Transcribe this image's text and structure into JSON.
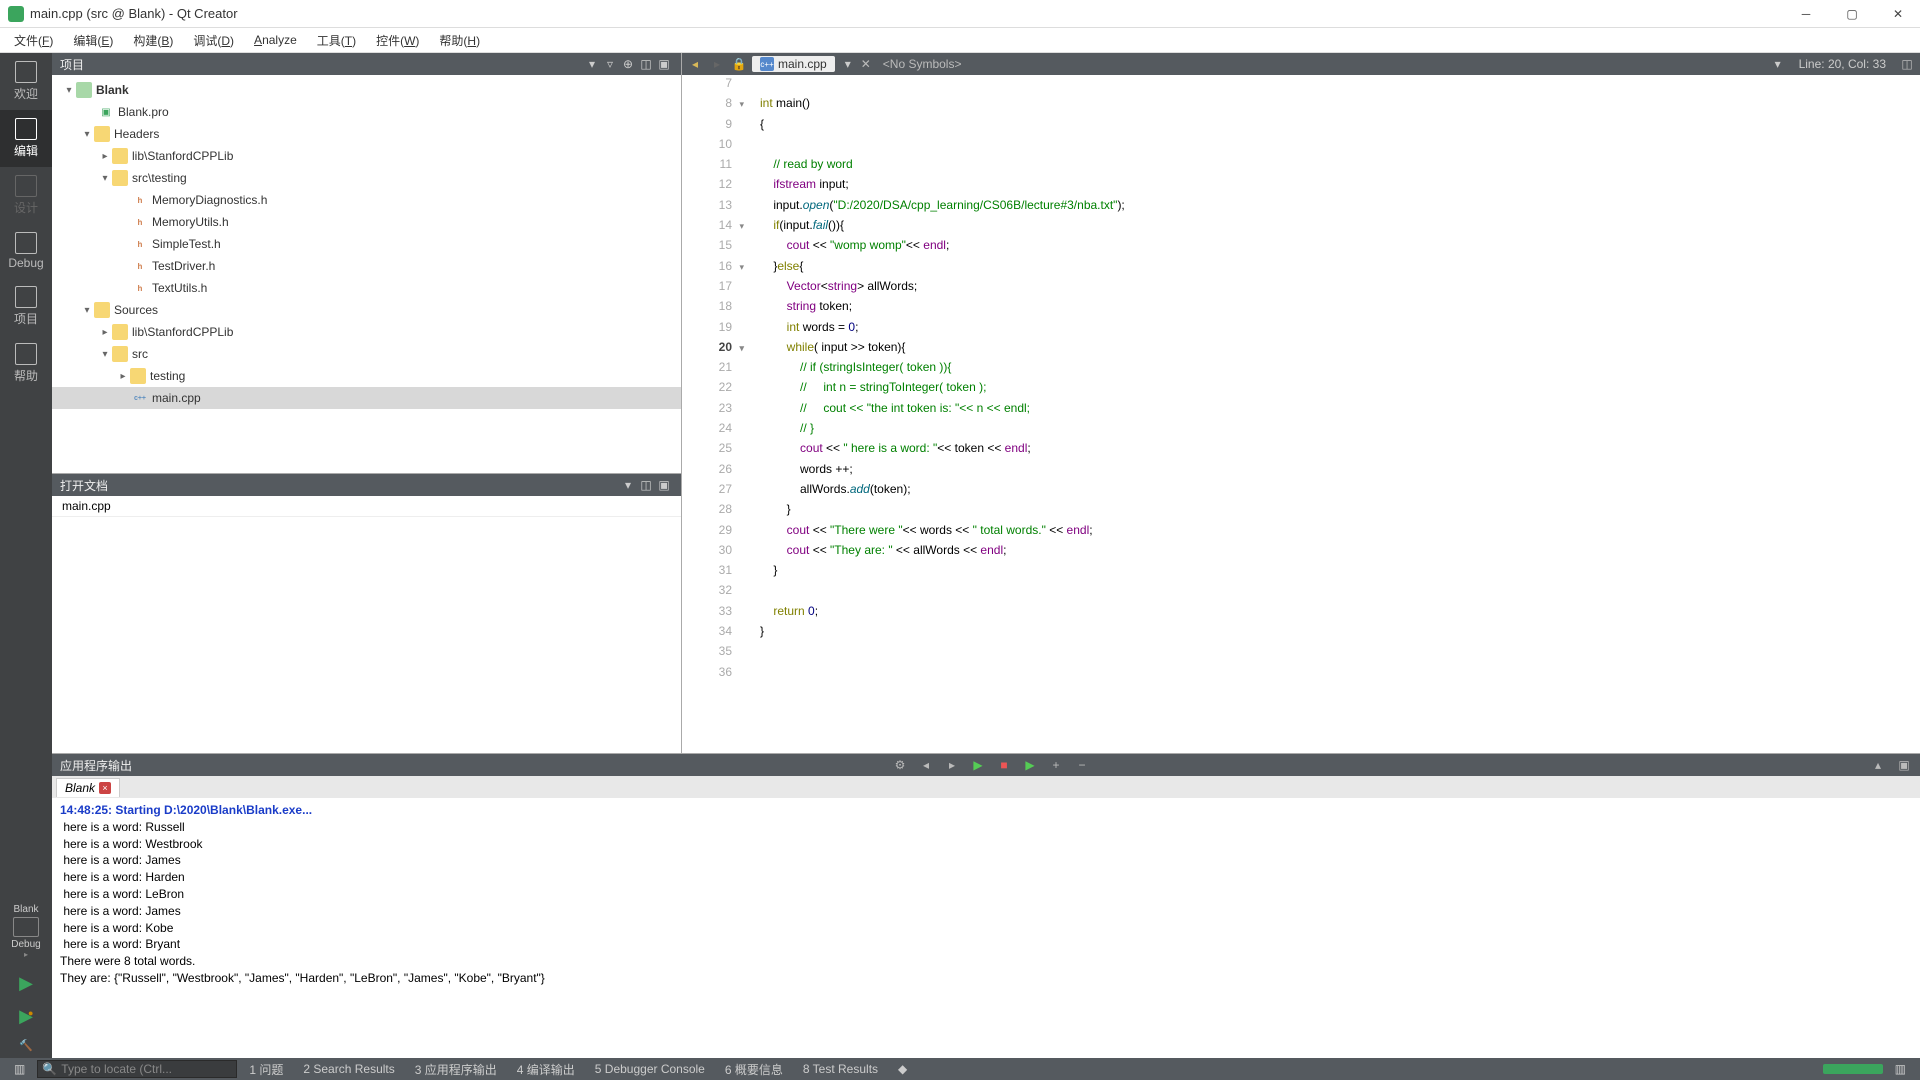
{
  "titlebar": {
    "title": "main.cpp (src @ Blank) - Qt Creator"
  },
  "menubar": {
    "items": [
      "文件(F)",
      "编辑(E)",
      "构建(B)",
      "调试(D)",
      "Analyze",
      "工具(T)",
      "控件(W)",
      "帮助(H)"
    ]
  },
  "leftnav": {
    "items": [
      {
        "label": "欢迎"
      },
      {
        "label": "编辑"
      },
      {
        "label": "设计"
      },
      {
        "label": "Debug"
      },
      {
        "label": "项目"
      },
      {
        "label": "帮助"
      }
    ],
    "target": {
      "name": "Blank",
      "config": "Debug"
    }
  },
  "project_panel": {
    "title": "项目",
    "tree": {
      "root": "Blank",
      "pro_file": "Blank.pro",
      "headers_label": "Headers",
      "lib_folder": "lib\\StanfordCPPLib",
      "testing_folder": "src\\testing",
      "header_files": [
        "MemoryDiagnostics.h",
        "MemoryUtils.h",
        "SimpleTest.h",
        "TestDriver.h",
        "TextUtils.h"
      ],
      "sources_label": "Sources",
      "src_folder": "src",
      "testing_sub": "testing",
      "main_file": "main.cpp"
    }
  },
  "open_docs": {
    "title": "打开文档",
    "items": [
      "main.cpp"
    ]
  },
  "editor": {
    "file": "main.cpp",
    "symbols": "<No Symbols>",
    "cursor": "Line: 20, Col: 33",
    "first_line": 7,
    "current_line": 20
  },
  "output": {
    "title": "应用程序输出",
    "tab": "Blank",
    "start": "14:48:25: Starting D:\\2020\\Blank\\Blank.exe...",
    "lines": [
      "here is a word: Russell",
      "here is a word: Westbrook",
      "here is a word: James",
      "here is a word: Harden",
      "here is a word: LeBron",
      "here is a word: James",
      "here is a word: Kobe",
      "here is a word: Bryant",
      "There were 8 total words.",
      "They are: {\"Russell\", \"Westbrook\", \"James\", \"Harden\", \"LeBron\", \"James\", \"Kobe\", \"Bryant\"}"
    ]
  },
  "statusbar": {
    "search_placeholder": "Type to locate (Ctrl...",
    "items": [
      "1  问题",
      "2  Search Results",
      "3  应用程序输出",
      "4  编译输出",
      "5  Debugger Console",
      "6  概要信息",
      "8  Test Results"
    ]
  }
}
